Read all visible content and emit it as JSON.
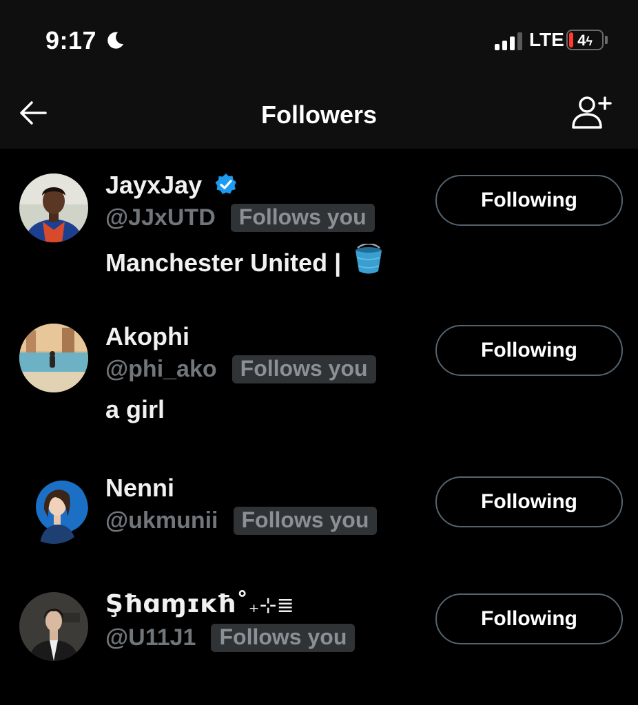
{
  "status_bar": {
    "time": "9:17",
    "network": "LTE",
    "battery": "4"
  },
  "header": {
    "title": "Followers"
  },
  "followers": [
    {
      "name": "JayxJay",
      "verified": true,
      "handle": "@JJxUTD",
      "follows_you": "Follows you",
      "bio": "Manchester United |",
      "button": "Following"
    },
    {
      "name": "Akophi",
      "verified": false,
      "handle": "@phi_ako",
      "follows_you": "Follows you",
      "bio": "a girl",
      "button": "Following"
    },
    {
      "name": "Nenni",
      "verified": false,
      "handle": "@ukmunii",
      "follows_you": "Follows you",
      "bio": "",
      "button": "Following"
    },
    {
      "name": "Şħɑɱɪĸħ˚",
      "name_suffix": "₊⊹≣",
      "verified": false,
      "handle": "@U11J1",
      "follows_you": "Follows you",
      "bio": "",
      "button": "Following"
    }
  ],
  "colors": {
    "background": "#000000",
    "header_background": "#0f0f0f",
    "verified_blue": "#1d9bf0",
    "muted_text": "#71767b",
    "badge_background": "#2f3336",
    "button_border": "#536471"
  }
}
